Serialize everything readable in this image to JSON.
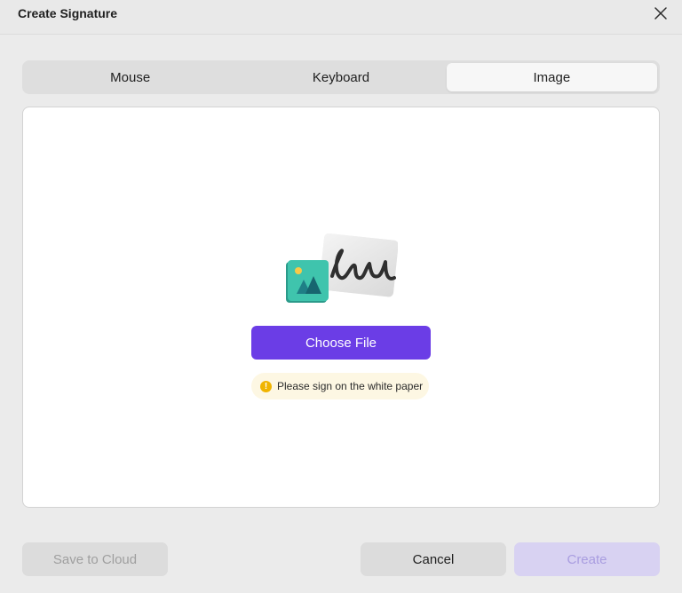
{
  "dialog": {
    "title": "Create Signature"
  },
  "tabs": [
    {
      "label": "Mouse",
      "active": false
    },
    {
      "label": "Keyboard",
      "active": false
    },
    {
      "label": "Image",
      "active": true
    }
  ],
  "canvas": {
    "choose_file_label": "Choose File",
    "hint_text": "Please sign on the white paper",
    "hint_icon": "!"
  },
  "footer": {
    "save_to_cloud_label": "Save to Cloud",
    "cancel_label": "Cancel",
    "create_label": "Create"
  },
  "colors": {
    "accent": "#6b3de6",
    "create_disabled": "#d8d2f2",
    "hint_background": "#fdf7e3",
    "hint_icon": "#f0b400"
  },
  "icons": {
    "close": "close-icon",
    "illustration": "signature-image-illustration",
    "hint": "warning-icon"
  }
}
